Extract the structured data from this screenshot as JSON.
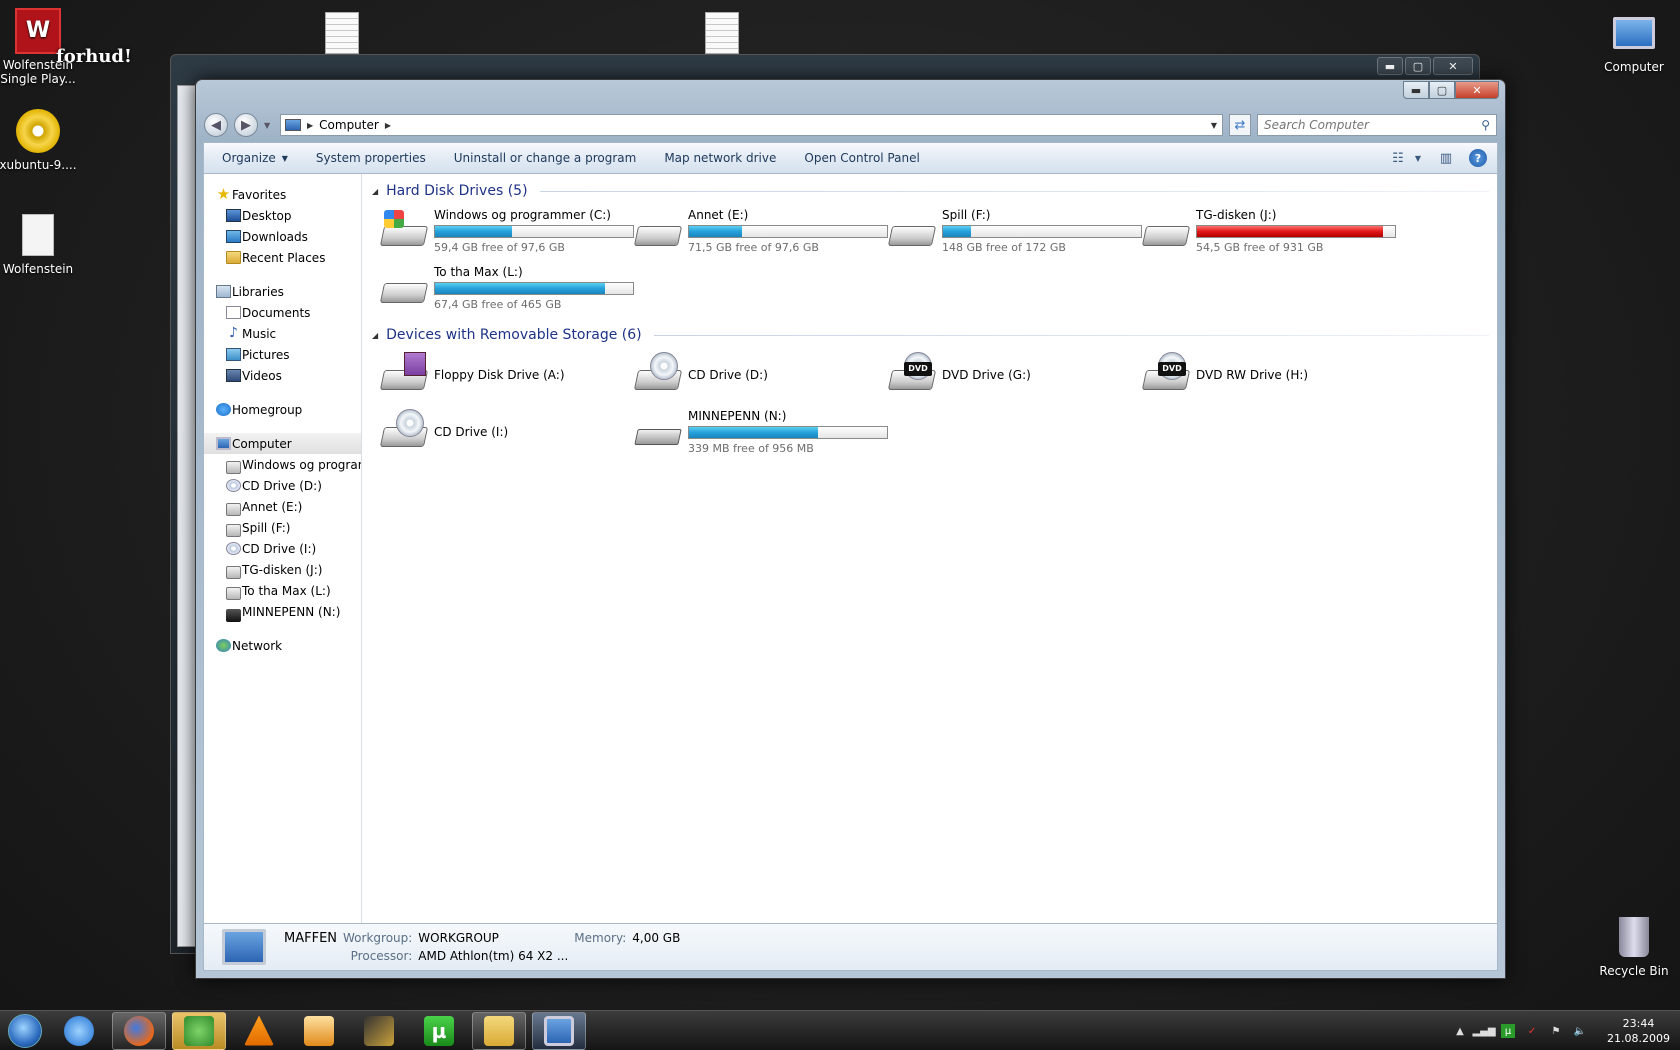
{
  "desktop": {
    "icons": [
      {
        "label1": "Wolfenstein",
        "label2": "Single Play...",
        "icon": "wolfenstein-logo-icon"
      },
      {
        "label1": "xubuntu-9....",
        "icon": "cd-image-icon"
      },
      {
        "label1": "Wolfenstein",
        "icon": "blank-file-icon"
      },
      {
        "label1": "Computer",
        "icon": "computer-icon"
      },
      {
        "label1": "Recycle Bin",
        "icon": "recycle-bin-icon"
      }
    ],
    "overlay_text": "forhud!"
  },
  "explorer": {
    "address": {
      "crumb": "Computer",
      "search_placeholder": "Search Computer"
    },
    "window_controls": {
      "minimize": "▬",
      "maximize": "▢",
      "close": "✕"
    },
    "toolbar": {
      "organize": "Organize",
      "system_properties": "System properties",
      "uninstall": "Uninstall or change a program",
      "map_drive": "Map network drive",
      "control_panel": "Open Control Panel"
    },
    "nav": {
      "favorites": "Favorites",
      "desktop": "Desktop",
      "downloads": "Downloads",
      "recent": "Recent Places",
      "libraries": "Libraries",
      "documents": "Documents",
      "music": "Music",
      "pictures": "Pictures",
      "videos": "Videos",
      "homegroup": "Homegroup",
      "computer": "Computer",
      "drives": [
        "Windows og programmer (C:)",
        "CD Drive (D:)",
        "Annet (E:)",
        "Spill (F:)",
        "CD Drive (I:)",
        "TG-disken (J:)",
        "To tha Max (L:)",
        "MINNEPENN (N:)"
      ],
      "network": "Network"
    },
    "sections": {
      "hdd_title": "Hard Disk Drives (5)",
      "removable_title": "Devices with Removable Storage (6)"
    },
    "hdd": [
      {
        "name": "Windows og programmer (C:)",
        "free": "59,4 GB free of 97,6 GB",
        "used_fraction": 0.39
      },
      {
        "name": "Annet (E:)",
        "free": "71,5 GB free of 97,6 GB",
        "used_fraction": 0.27
      },
      {
        "name": "Spill (F:)",
        "free": "148 GB free of 172 GB",
        "used_fraction": 0.14
      },
      {
        "name": "TG-disken (J:)",
        "free": "54,5 GB free of 931 GB",
        "used_fraction": 0.94,
        "warning": true
      },
      {
        "name": "To tha Max (L:)",
        "free": "67,4 GB free of 465 GB",
        "used_fraction": 0.86
      }
    ],
    "removable": [
      {
        "name": "Floppy Disk Drive (A:)"
      },
      {
        "name": "CD Drive (D:)"
      },
      {
        "name": "DVD Drive (G:)",
        "badge": "DVD"
      },
      {
        "name": "DVD RW Drive (H:)",
        "badge": "DVD"
      },
      {
        "name": "CD Drive (I:)"
      },
      {
        "name": "MINNEPENN (N:)",
        "free": "339 MB free of 956 MB",
        "used_fraction": 0.65
      }
    ],
    "details": {
      "computer_name": "MAFFEN",
      "workgroup_label": "Workgroup:",
      "workgroup": "WORKGROUP",
      "memory_label": "Memory:",
      "memory": "4,00 GB",
      "processor_label": "Processor:",
      "processor": "AMD Athlon(tm) 64 X2 ..."
    }
  },
  "taskbar": {
    "clock_time": "23:44",
    "clock_date": "21.08.2009"
  },
  "colors": {
    "bar_blue": "#26a0da",
    "bar_red": "#e01818",
    "link_blue": "#1e3287"
  }
}
